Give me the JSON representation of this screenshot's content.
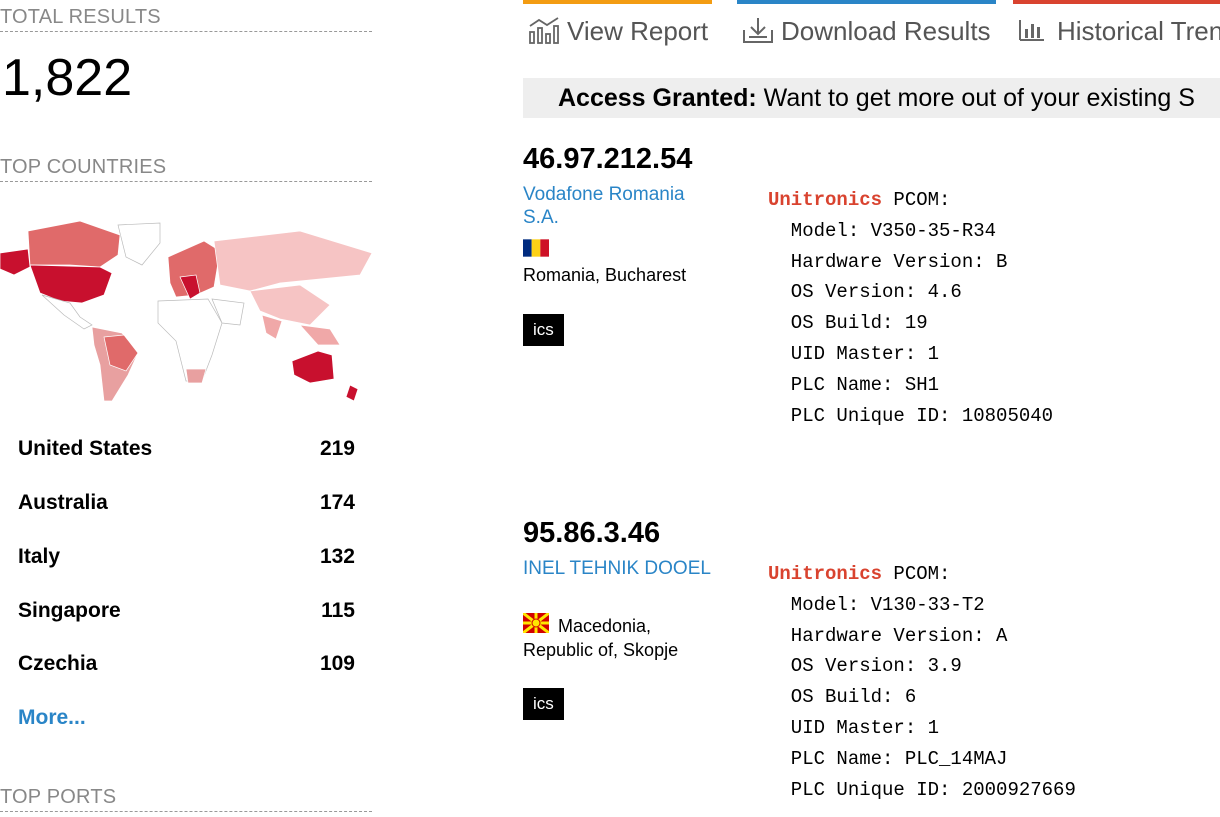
{
  "summary": {
    "total_results_label": "TOTAL RESULTS",
    "total_results_value": "1,822",
    "top_countries_label": "TOP COUNTRIES",
    "top_ports_label": "TOP PORTS",
    "countries": [
      {
        "name": "United States",
        "count": "219"
      },
      {
        "name": "Australia",
        "count": "174"
      },
      {
        "name": "Italy",
        "count": "132"
      },
      {
        "name": "Singapore",
        "count": "115"
      },
      {
        "name": "Czechia",
        "count": "109"
      }
    ],
    "more_label": "More..."
  },
  "tabs": [
    {
      "label": "View Report",
      "icon": "chart-icon",
      "color": "#f39c12"
    },
    {
      "label": "Download Results",
      "icon": "download-icon",
      "color": "#2a85c7"
    },
    {
      "label": "Historical Tren",
      "icon": "bar-chart-icon",
      "color": "#d9432f"
    }
  ],
  "banner": {
    "bold": "Access Granted:",
    "text": " Want to get more out of your existing S"
  },
  "results": [
    {
      "ip": "46.97.212.54",
      "org": "Vodafone Romania S.A.",
      "flag": "romania-flag",
      "location": "Romania, Bucharest",
      "tag": "ics",
      "vendor": "Unitronics",
      "protocol": " PCOM:",
      "lines": [
        "  Model: V350-35-R34",
        "  Hardware Version: B",
        "  OS Version: 4.6",
        "  OS Build: 19",
        "  UID Master: 1",
        "  PLC Name: SH1",
        "  PLC Unique ID: 10805040"
      ]
    },
    {
      "ip": "95.86.3.46",
      "org": "INEL TEHNIK DOOEL",
      "flag": "macedonia-flag",
      "location": "Macedonia, Republic of, Skopje",
      "tag": "ics",
      "vendor": "Unitronics",
      "protocol": " PCOM:",
      "lines": [
        "  Model: V130-33-T2",
        "  Hardware Version: A",
        "  OS Version: 3.9",
        "  OS Build: 6",
        "  UID Master: 1",
        "  PLC Name: PLC_14MAJ",
        "  PLC Unique ID: 2000927669"
      ]
    }
  ],
  "colors": {
    "link": "#2a85c7",
    "vendor": "#d9432f",
    "map_dark": "#c8102e",
    "map_mid": "#e06a6a",
    "map_light": "#f6c4c4"
  }
}
